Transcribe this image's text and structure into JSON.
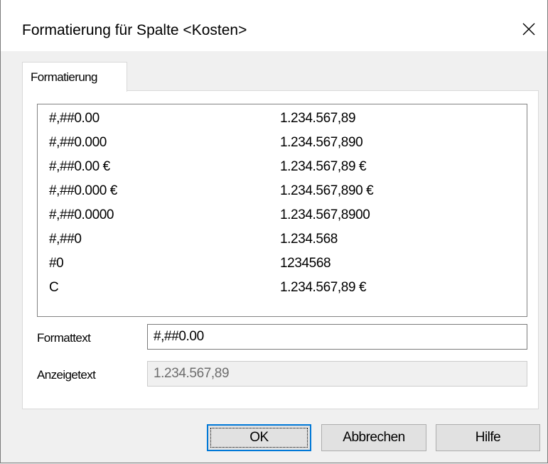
{
  "window": {
    "title": "Formatierung für Spalte <Kosten>"
  },
  "tabs": [
    {
      "label": "Formatierung",
      "active": true
    }
  ],
  "format_list": [
    {
      "format": "#,##0.00",
      "example": "1.234.567,89"
    },
    {
      "format": "#,##0.000",
      "example": "1.234.567,890"
    },
    {
      "format": "#,##0.00 €",
      "example": "1.234.567,89 €"
    },
    {
      "format": "#,##0.000 €",
      "example": "1.234.567,890 €"
    },
    {
      "format": "#,##0.0000",
      "example": "1.234.567,8900"
    },
    {
      "format": "#,##0",
      "example": "1.234.568"
    },
    {
      "format": "#0",
      "example": "1234568"
    },
    {
      "format": "C",
      "example": "1.234.567,89 €"
    }
  ],
  "fields": {
    "formattext_label": "Formattext",
    "formattext_value": "#,##0.00",
    "anzeigetext_label": "Anzeigetext",
    "anzeigetext_value": "1.234.567,89"
  },
  "buttons": {
    "ok": "OK",
    "cancel": "Abbrechen",
    "help": "Hilfe"
  },
  "icons": {
    "close": "close-icon"
  },
  "colors": {
    "focus_border": "#0078d7",
    "button_face": "#e1e1e1",
    "dialog_background": "#f0f0f0"
  }
}
